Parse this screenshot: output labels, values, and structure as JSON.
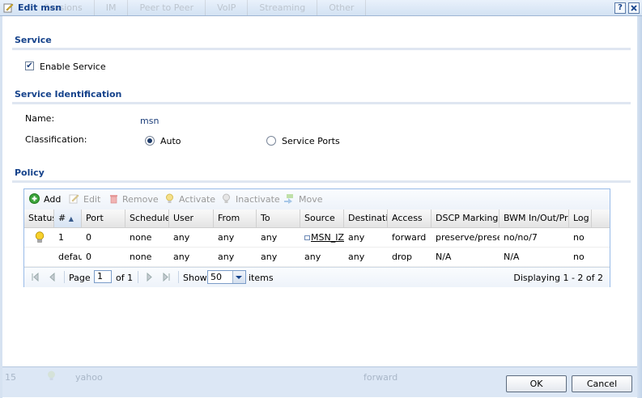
{
  "window": {
    "title": "Edit msn",
    "help_label": "?",
    "close_label": "X",
    "background_tabs": [
      "Sessions",
      "IM",
      "Peer to Peer",
      "VoIP",
      "Streaming",
      "Other"
    ]
  },
  "service": {
    "heading": "Service",
    "enable_label": "Enable Service",
    "enable_checked": true
  },
  "identification": {
    "heading": "Service Identification",
    "name_label": "Name:",
    "name_value": "msn",
    "classification_label": "Classification:",
    "options": [
      {
        "label": "Auto",
        "selected": true
      },
      {
        "label": "Service Ports",
        "selected": false
      }
    ]
  },
  "policy": {
    "heading": "Policy",
    "toolbar": [
      {
        "label": "Add",
        "icon": "add-icon",
        "enabled": true
      },
      {
        "label": "Edit",
        "icon": "edit-icon",
        "enabled": false
      },
      {
        "label": "Remove",
        "icon": "remove-icon",
        "enabled": false
      },
      {
        "label": "Activate",
        "icon": "bulb-on-icon",
        "enabled": false
      },
      {
        "label": "Inactivate",
        "icon": "bulb-off-icon",
        "enabled": false
      },
      {
        "label": "Move",
        "icon": "move-icon",
        "enabled": false
      }
    ],
    "columns": [
      "Status",
      "#",
      "Port",
      "Schedule",
      "User",
      "From",
      "To",
      "Source",
      "Destination",
      "Access",
      "DSCP Marking In",
      "BWM In/Out/Pri",
      "Log"
    ],
    "rows": [
      {
        "status_icon": "lightbulb-icon",
        "num": "1",
        "port": "0",
        "schedule": "none",
        "user": "any",
        "from": "any",
        "to": "any",
        "source": "MSN_IZI",
        "destination": "any",
        "access": "forward",
        "dscp": "preserve/preser",
        "bwm": "no/no/7",
        "log": "no"
      },
      {
        "status_icon": "",
        "num": "defau",
        "port": "0",
        "schedule": "none",
        "user": "any",
        "from": "any",
        "to": "any",
        "source": "any",
        "destination": "any",
        "access": "drop",
        "dscp": "N/A",
        "bwm": "N/A",
        "log": "no"
      }
    ],
    "pager": {
      "page_label": "Page",
      "page_value": "1",
      "of_label": "of 1",
      "show_label": "Show",
      "show_value": "50",
      "items_label": "items",
      "display_text": "Displaying 1 - 2 of 2"
    }
  },
  "background_row": {
    "num": "15",
    "name": "yahoo",
    "access": "forward"
  },
  "buttons": {
    "ok": "OK",
    "cancel": "Cancel"
  },
  "colors": {
    "heading": "#15428b",
    "title_bar": "#d3e2f3",
    "footer": "#dce7f5",
    "grid_border": "#99bbe8"
  }
}
